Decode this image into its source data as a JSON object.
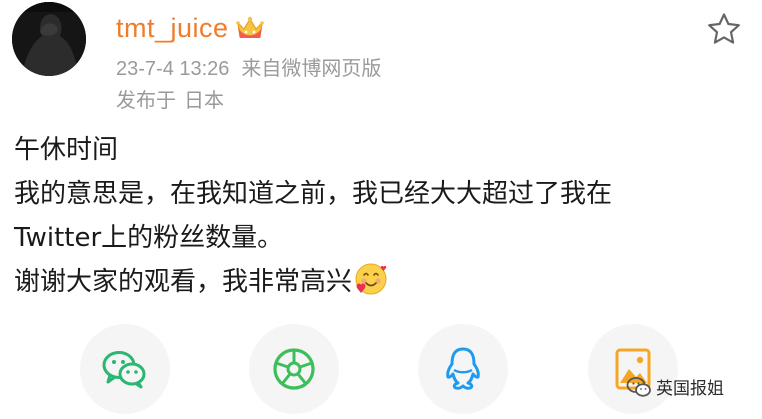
{
  "header": {
    "username": "tmt_juice",
    "timestamp": "23-7-4 13:26",
    "source": "来自微博网页版",
    "location_prefix": "发布于",
    "location": "日本",
    "favorite_icon": "star-outline-icon",
    "vip_icon": "crown-badge-icon"
  },
  "post": {
    "lines": [
      "午休时间",
      "我的意思是，在我知道之前，我已经大大超过了我在",
      "Twitter上的粉丝数量。",
      "谢谢大家的观看，我非常高兴"
    ],
    "trailing_emoji": "smiling-face-with-hearts"
  },
  "share_bar": {
    "buttons": [
      {
        "name": "wechat-share-button",
        "icon": "wechat-icon"
      },
      {
        "name": "moments-share-button",
        "icon": "moments-icon"
      },
      {
        "name": "qq-share-button",
        "icon": "qq-icon"
      },
      {
        "name": "image-share-button",
        "icon": "image-icon"
      }
    ]
  },
  "watermark": {
    "text": "英国报姐",
    "icon": "wechat-official-account-icon"
  },
  "colors": {
    "username": "#f07c2a",
    "meta": "#9a9a9a",
    "wechat": "#2bb673",
    "moments": "#3cbf5a",
    "qq": "#1e9bf0",
    "image": "#f5a623"
  }
}
